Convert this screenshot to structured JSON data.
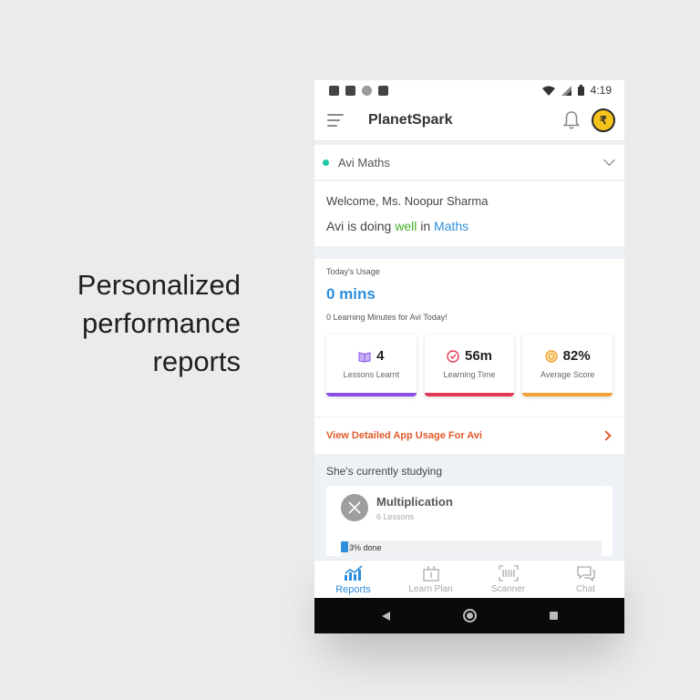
{
  "promo": {
    "line1": "Personalized",
    "line2": "performance",
    "line3": "reports"
  },
  "status": {
    "time": "4:19",
    "left_icons": [
      "settings-icon",
      "a-icon",
      "circle-icon",
      "sd-card-icon"
    ],
    "right_icons": [
      "wifi-icon",
      "signal-icon",
      "battery-icon"
    ]
  },
  "appbar": {
    "title": "PlanetSpark",
    "coin_symbol": "₹"
  },
  "selector": {
    "label": "Avi Maths",
    "dot_color": "#1fc7a8"
  },
  "welcome": {
    "greeting": "Welcome, Ms. Noopur Sharma",
    "status_prefix": "Avi is doing ",
    "status_word": "well",
    "status_mid": " in ",
    "status_subject": "Maths"
  },
  "usage": {
    "label": "Today's Usage",
    "value": "0 mins",
    "sub": "0 Learning Minutes for Avi Today!"
  },
  "cards": [
    {
      "value": "4",
      "label": "Lessons Learnt",
      "icon": "book-icon",
      "color": "#8a4de8"
    },
    {
      "value": "56m",
      "label": "Learning Time",
      "icon": "clock-icon",
      "color": "#e23a57"
    },
    {
      "value": "82%",
      "label": "Average Score",
      "icon": "medal-icon",
      "color": "#f2a23a"
    }
  ],
  "detail_link": "View Detailed App Usage For Avi",
  "studying": {
    "heading": "She's currently studying",
    "course_title": "Multiplication",
    "course_sub": "6 Lessons",
    "progress_text": "3% done",
    "progress": 0.03
  },
  "bottomnav": {
    "items": [
      {
        "label": "Reports",
        "icon": "chart-icon",
        "active": true
      },
      {
        "label": "Learn Plan",
        "icon": "learn-plan-icon",
        "active": false
      },
      {
        "label": "Scanner",
        "icon": "scanner-icon",
        "active": false
      },
      {
        "label": "Chat",
        "icon": "chat-icon",
        "active": false
      }
    ]
  },
  "colors": {
    "accent_blue": "#2e8ede",
    "accent_green": "#43b02a",
    "link_orange": "#e25a2c"
  }
}
